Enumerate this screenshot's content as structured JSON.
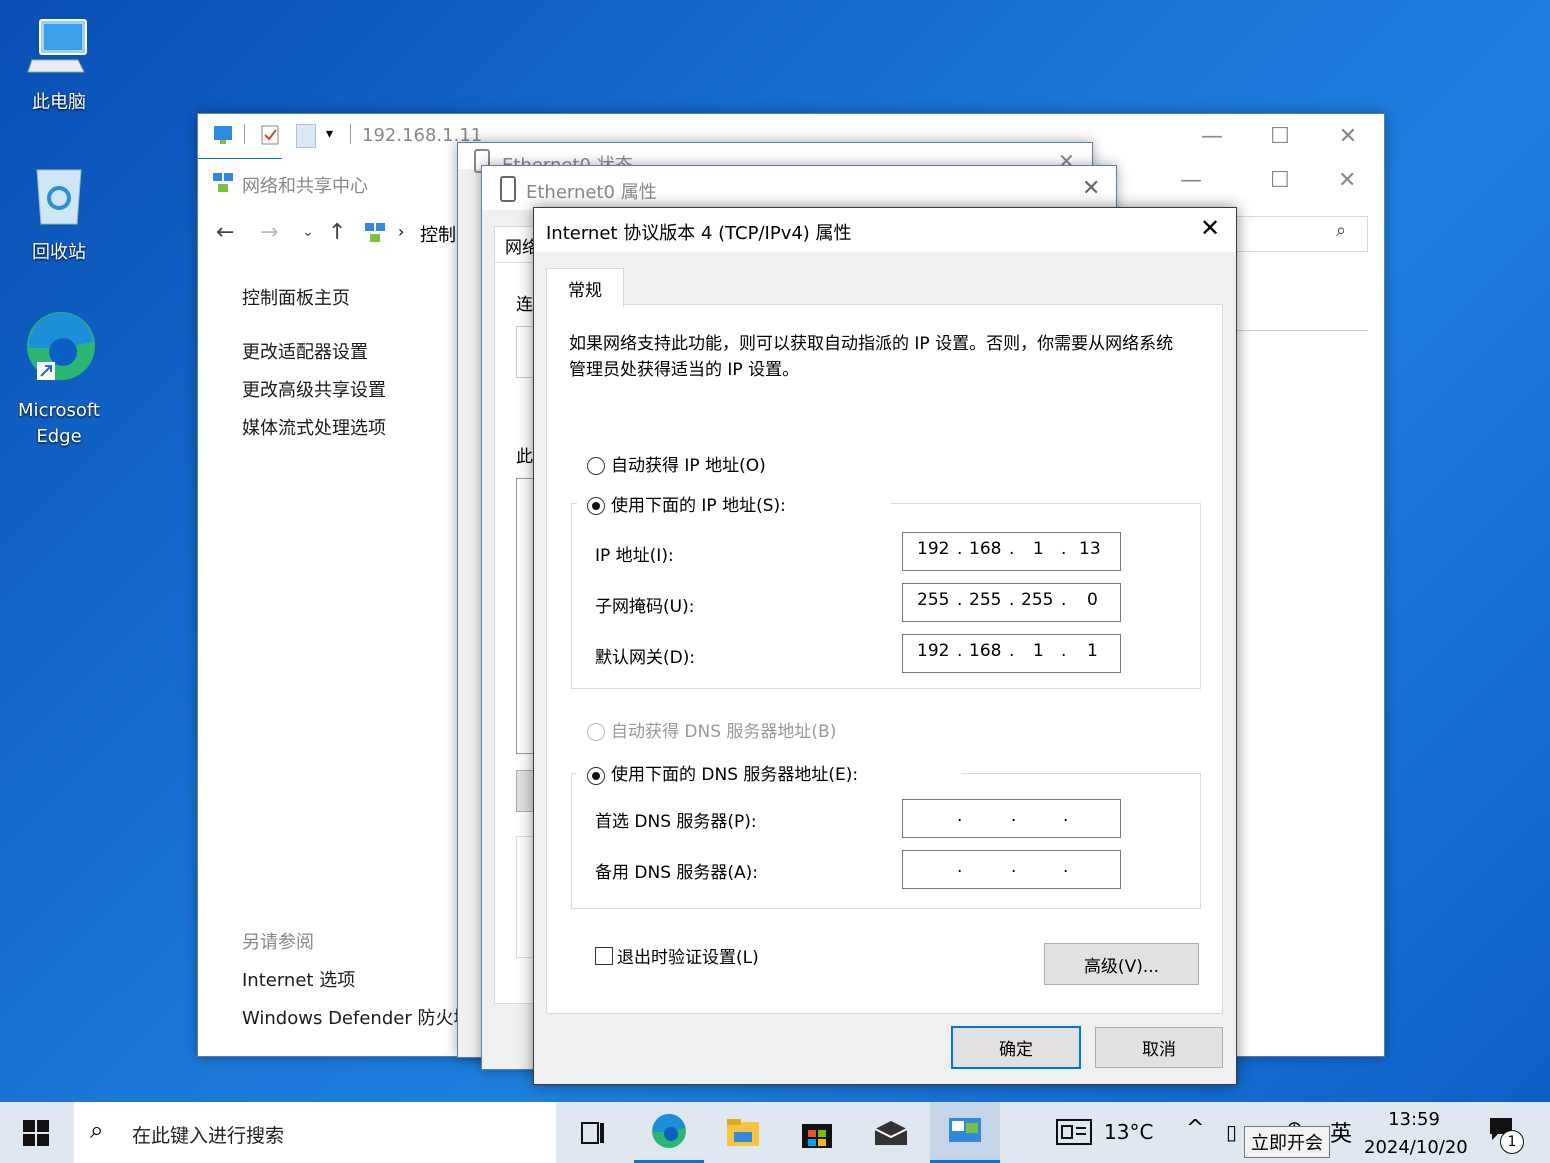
{
  "desktop": {
    "icons": [
      {
        "label": "此电脑"
      },
      {
        "label": "回收站"
      },
      {
        "label": "Microsoft Edge"
      }
    ]
  },
  "explorer": {
    "address": "192.168.1.11",
    "window_title": "网络和共享中心",
    "breadcrumb": "控制",
    "sidebar": {
      "home": "控制面板主页",
      "items": [
        "更改适配器设置",
        "更改高级共享设置",
        "媒体流式处理选项"
      ],
      "see_also": "另请参阅",
      "see_also_items": [
        "Internet 选项",
        "Windows Defender 防火墙"
      ]
    }
  },
  "status_window": {
    "title": "Ethernet0 状态"
  },
  "props_window": {
    "title": "Ethernet0 属性",
    "partial_labels": [
      "网络",
      "连",
      "此"
    ]
  },
  "dialog": {
    "title": "Internet 协议版本 4 (TCP/IPv4) 属性",
    "tab": "常规",
    "description": "如果网络支持此功能，则可以获取自动指派的 IP 设置。否则，你需要从网络系统管理员处获得适当的 IP 设置。",
    "auto_ip": "自动获得 IP 地址(O)",
    "manual_ip": "使用下面的 IP 地址(S):",
    "ip_label": "IP 地址(I):",
    "ip_value": [
      "192",
      "168",
      "1",
      "13"
    ],
    "mask_label": "子网掩码(U):",
    "mask_value": [
      "255",
      "255",
      "255",
      "0"
    ],
    "gateway_label": "默认网关(D):",
    "gateway_value": [
      "192",
      "168",
      "1",
      "1"
    ],
    "auto_dns": "自动获得 DNS 服务器地址(B)",
    "manual_dns": "使用下面的 DNS 服务器地址(E):",
    "preferred_dns_label": "首选 DNS 服务器(P):",
    "alternate_dns_label": "备用 DNS 服务器(A):",
    "validate_label": "退出时验证设置(L)",
    "advanced_button": "高级(V)...",
    "ok_button": "确定",
    "cancel_button": "取消"
  },
  "taskbar": {
    "search_placeholder": "在此键入进行搜索",
    "weather": "13°C",
    "ime": "英",
    "tooltip": "立即开会",
    "time": "13:59",
    "date": "2024/10/20",
    "notification_count": "1"
  }
}
